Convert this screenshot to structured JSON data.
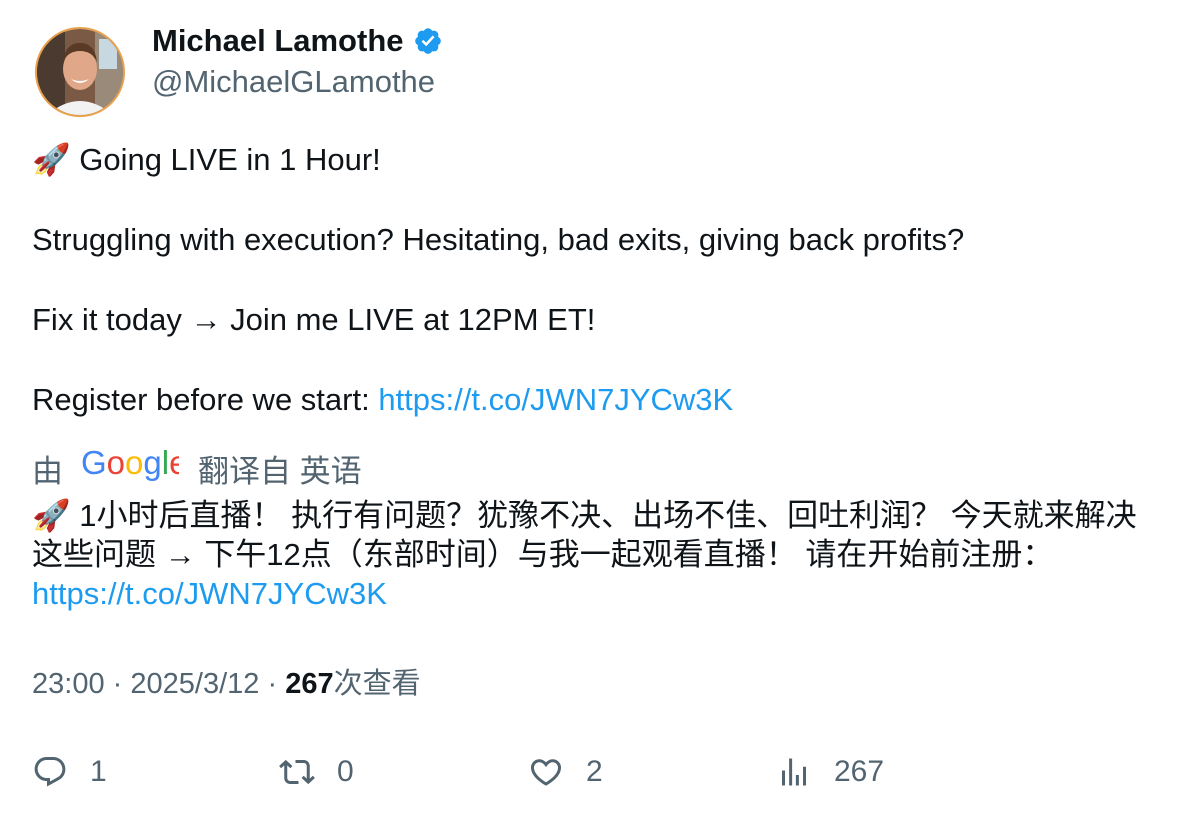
{
  "author": {
    "display_name": "Michael Lamothe",
    "handle": "@MichaelGLamothe",
    "verified": true,
    "verified_color": "#1d9bf0"
  },
  "tweet": {
    "line1": "🚀 Going LIVE in 1 Hour!",
    "line2": "Struggling with execution? Hesitating, bad exits, giving back profits?",
    "line3": "Fix it today → Join me LIVE at 12PM ET!",
    "line4_prefix": "Register before we start: ",
    "link": "https://t.co/JWN7JYCw3K"
  },
  "translation": {
    "by_label": "由",
    "provider": "Google",
    "from_label": "翻译自 英语",
    "text": "🚀 1小时后直播！ 执行有问题？犹豫不决、出场不佳、回吐利润？ 今天就来解决这些问题 → 下午12点（东部时间）与我一起观看直播！ 请在开始前注册：",
    "link": "https://t.co/JWN7JYCw3K"
  },
  "meta": {
    "time": "23:00",
    "separator": "·",
    "date": "2025/3/12",
    "views_count": "267",
    "views_label": "次查看"
  },
  "actions": {
    "reply_count": "1",
    "retweet_count": "0",
    "like_count": "2",
    "views_count": "267"
  },
  "colors": {
    "link": "#1d9bf0",
    "secondary_text": "#536471",
    "primary_text": "#0f1419"
  }
}
